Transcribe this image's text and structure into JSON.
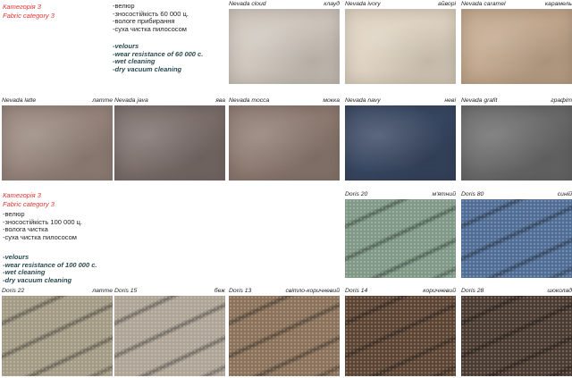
{
  "section1": {
    "category_ua": "Категорія 3",
    "category_en": "Fabric category 3",
    "props_ua": [
      "-велюр",
      "-зносостійкість 60 000 ц.",
      "-вологе прибирання",
      "-суха чистка пилососом"
    ],
    "props_en": [
      "-velours",
      "-wear resistance of 60 000 c.",
      "-wet cleaning",
      "-dry vacuum cleaning"
    ]
  },
  "section2": {
    "category_ua": "Категорія 3",
    "category_en": "Fabric category 3",
    "props_ua": [
      "-велюр",
      "-зносостійкість 100 000 ц.",
      "-волога чистка",
      "-суха чистка пилососом"
    ],
    "props_en": [
      "-velours",
      "-wear resistance of 100 000 c.",
      "-wet cleaning",
      "-dry vacuum cleaning"
    ]
  },
  "swatches": [
    {
      "name": "Nevada cloud",
      "ua": "клауд",
      "color": "#cdc5bb"
    },
    {
      "name": "Nevada ivory",
      "ua": "айворі",
      "color": "#ddd1bf"
    },
    {
      "name": "Nevada caramel",
      "ua": "карамель",
      "color": "#c1a68b"
    },
    {
      "name": "Nevada latte",
      "ua": "латте",
      "color": "#96847b"
    },
    {
      "name": "Nevada java",
      "ua": "ява",
      "color": "#7a6d6a"
    },
    {
      "name": "Nevada mocca",
      "ua": "мокка",
      "color": "#8d7a70"
    },
    {
      "name": "Nevada navy",
      "ua": "неві",
      "color": "#374661"
    },
    {
      "name": "Nevada grafit",
      "ua": "графіт",
      "color": "#6a6a6a"
    },
    {
      "name": "Doris 20",
      "ua": "м'ятний",
      "color": "#7f9986"
    },
    {
      "name": "Doris 80",
      "ua": "синій",
      "color": "#4f6d96"
    },
    {
      "name": "Doris 22",
      "ua": "латте",
      "color": "#a39a84"
    },
    {
      "name": "Doris 15",
      "ua": "беж",
      "color": "#aea496"
    },
    {
      "name": "Doris 13",
      "ua": "світло-коричневий",
      "color": "#8a7159"
    },
    {
      "name": "Doris 14",
      "ua": "коричневий",
      "color": "#5c4433"
    },
    {
      "name": "Doris 28",
      "ua": "шоколад",
      "color": "#4a3a2f"
    }
  ]
}
